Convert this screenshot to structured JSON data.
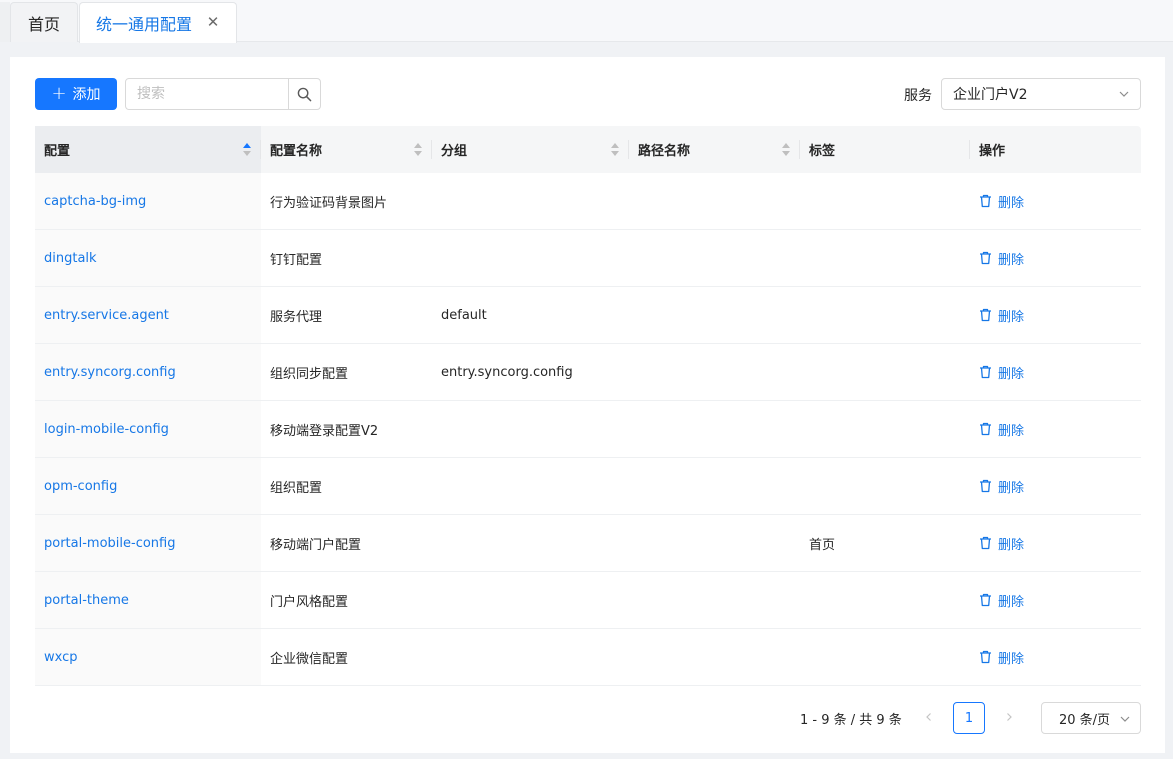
{
  "tabs": [
    {
      "label": "首页"
    },
    {
      "label": "统一通用配置"
    }
  ],
  "toolbar": {
    "add_label": "添加",
    "search_placeholder": "搜索",
    "service_label": "服务",
    "service_value": "企业门户V2"
  },
  "table": {
    "headers": [
      "配置",
      "配置名称",
      "分组",
      "路径名称",
      "标签",
      "操作"
    ],
    "delete_label": "删除",
    "rows": [
      {
        "key": "captcha-bg-img",
        "name": "行为验证码背景图片",
        "group": "",
        "path": "",
        "tag": ""
      },
      {
        "key": "dingtalk",
        "name": "钉钉配置",
        "group": "",
        "path": "",
        "tag": ""
      },
      {
        "key": "entry.service.agent",
        "name": "服务代理",
        "group": "default",
        "path": "",
        "tag": ""
      },
      {
        "key": "entry.syncorg.config",
        "name": "组织同步配置",
        "group": "entry.syncorg.config",
        "path": "",
        "tag": ""
      },
      {
        "key": "login-mobile-config",
        "name": "移动端登录配置V2",
        "group": "",
        "path": "",
        "tag": ""
      },
      {
        "key": "opm-config",
        "name": "组织配置",
        "group": "",
        "path": "",
        "tag": ""
      },
      {
        "key": "portal-mobile-config",
        "name": "移动端门户配置",
        "group": "",
        "path": "",
        "tag": "首页"
      },
      {
        "key": "portal-theme",
        "name": "门户风格配置",
        "group": "",
        "path": "",
        "tag": ""
      },
      {
        "key": "wxcp",
        "name": "企业微信配置",
        "group": "",
        "path": "",
        "tag": ""
      }
    ]
  },
  "pagination": {
    "total_text": "1 - 9 条 / 共 9 条",
    "current_page": "1",
    "page_size": "20 条/页"
  },
  "colors": {
    "primary": "#1677ff",
    "link": "#1677e6"
  }
}
